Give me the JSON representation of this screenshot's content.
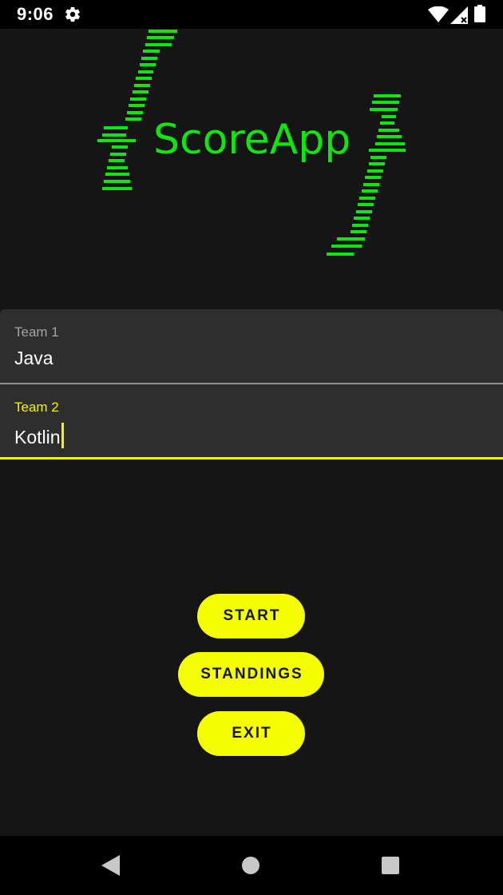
{
  "status_bar": {
    "time": "9:06",
    "icons": [
      "gear-icon",
      "wifi-icon",
      "signal-icon",
      "battery-icon"
    ]
  },
  "logo": {
    "text": "ScoreApp",
    "color": "#10e510"
  },
  "form": {
    "team1": {
      "label": "Team 1",
      "value": "Java"
    },
    "team2": {
      "label": "Team 2",
      "value": "Kotlin",
      "focused": true
    }
  },
  "buttons": {
    "start": "START",
    "standings": "STANDINGS",
    "exit": "EXIT"
  },
  "nav_bar": {
    "icons": [
      "back-icon",
      "home-icon",
      "recents-icon"
    ]
  },
  "colors": {
    "accent": "#f5ff00",
    "background": "#151515",
    "field_background": "#2e2e2e",
    "logo_green": "#10e510"
  }
}
